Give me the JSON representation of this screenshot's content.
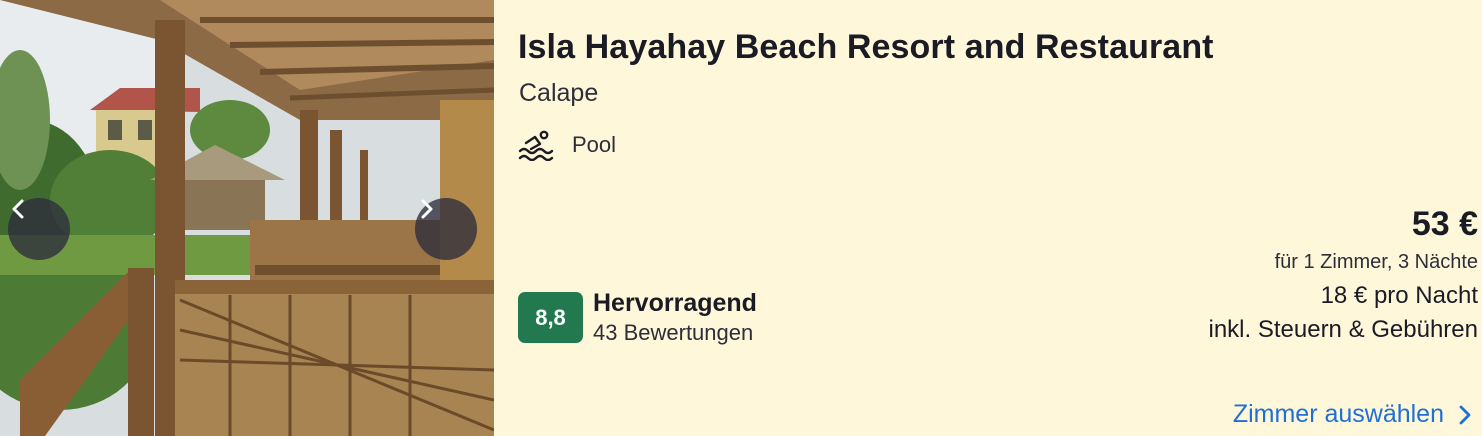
{
  "hotel": {
    "name": "Isla Hayahay Beach Resort and Restaurant",
    "location": "Calape",
    "amenity": {
      "icon": "pool-icon",
      "label": "Pool"
    }
  },
  "rating": {
    "score": "8,8",
    "label": "Hervorragend",
    "count": "43 Bewertungen",
    "color": "#227950"
  },
  "price": {
    "total": "53 €",
    "detail": "für 1 Zimmer, 3 Nächte",
    "per_night": "18 € pro Nacht",
    "taxes": "inkl. Steuern & Gebühren"
  },
  "cta": {
    "label": "Zimmer auswählen",
    "color": "#1f6fd6"
  },
  "gallery": {
    "prev_icon": "chevron-left-icon",
    "next_icon": "chevron-right-icon"
  },
  "colors": {
    "background": "#fef7d9"
  }
}
